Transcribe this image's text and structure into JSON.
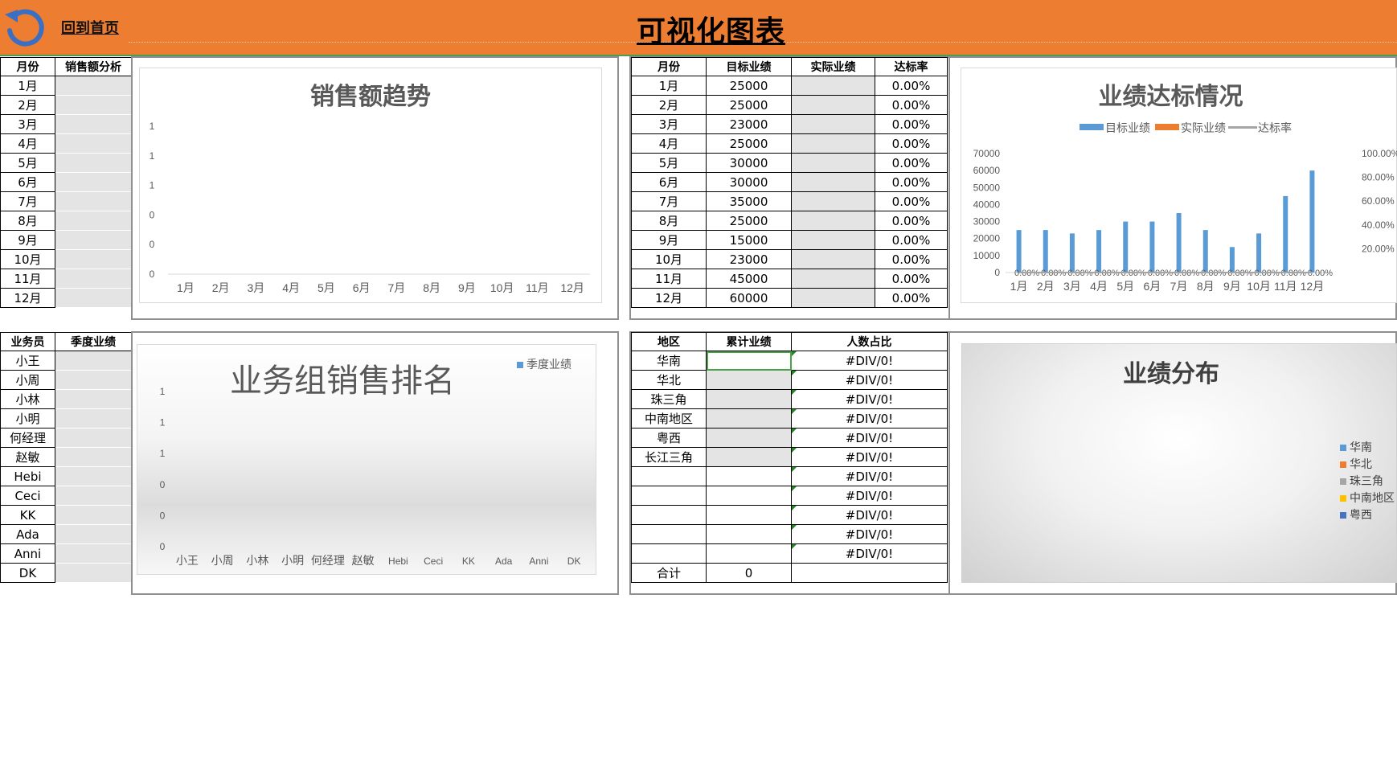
{
  "header": {
    "home_label": "回到首页",
    "title": "可视化图表",
    "bg_color": "#ED7D31"
  },
  "sales_table": {
    "headers": [
      "月份",
      "销售额分析"
    ],
    "rows": [
      "1月",
      "2月",
      "3月",
      "4月",
      "5月",
      "6月",
      "7月",
      "8月",
      "9月",
      "10月",
      "11月",
      "12月"
    ]
  },
  "sales_trend_chart": {
    "title": "销售额趋势",
    "y_ticks": [
      "0",
      "0",
      "0",
      "1",
      "1",
      "1"
    ],
    "x_labels": [
      "1月",
      "2月",
      "3月",
      "4月",
      "5月",
      "6月",
      "7月",
      "8月",
      "9月",
      "10月",
      "11月",
      "12月"
    ]
  },
  "target_table": {
    "headers": [
      "月份",
      "目标业绩",
      "实际业绩",
      "达标率"
    ],
    "rows": [
      {
        "month": "1月",
        "target": "25000",
        "actual": "",
        "rate": "0.00%"
      },
      {
        "month": "2月",
        "target": "25000",
        "actual": "",
        "rate": "0.00%"
      },
      {
        "month": "3月",
        "target": "23000",
        "actual": "",
        "rate": "0.00%"
      },
      {
        "month": "4月",
        "target": "25000",
        "actual": "",
        "rate": "0.00%"
      },
      {
        "month": "5月",
        "target": "30000",
        "actual": "",
        "rate": "0.00%"
      },
      {
        "month": "6月",
        "target": "30000",
        "actual": "",
        "rate": "0.00%"
      },
      {
        "month": "7月",
        "target": "35000",
        "actual": "",
        "rate": "0.00%"
      },
      {
        "month": "8月",
        "target": "25000",
        "actual": "",
        "rate": "0.00%"
      },
      {
        "month": "9月",
        "target": "15000",
        "actual": "",
        "rate": "0.00%"
      },
      {
        "month": "10月",
        "target": "23000",
        "actual": "",
        "rate": "0.00%"
      },
      {
        "month": "11月",
        "target": "45000",
        "actual": "",
        "rate": "0.00%"
      },
      {
        "month": "12月",
        "target": "60000",
        "actual": "",
        "rate": "0.00%"
      }
    ]
  },
  "salesman_table": {
    "headers": [
      "业务员",
      "季度业绩"
    ],
    "rows": [
      "小王",
      "小周",
      "小林",
      "小明",
      "何经理",
      "赵敏",
      "Hebi",
      "Ceci",
      "KK",
      "Ada",
      "Anni",
      "DK"
    ]
  },
  "ranking_chart": {
    "title": "业务组销售排名",
    "legend": "季度业绩",
    "y_ticks": [
      "0",
      "0",
      "0",
      "1",
      "1",
      "1"
    ],
    "x_labels": [
      "小王",
      "小周",
      "小林",
      "小明",
      "何经理",
      "赵敏",
      "Hebi",
      "Ceci",
      "KK",
      "Ada",
      "Anni",
      "DK"
    ]
  },
  "region_table": {
    "headers": [
      "地区",
      "累计业绩",
      "人数占比"
    ],
    "rows": [
      {
        "region": "华南",
        "total": "",
        "ratio": "#DIV/0!"
      },
      {
        "region": "华北",
        "total": "",
        "ratio": "#DIV/0!"
      },
      {
        "region": "珠三角",
        "total": "",
        "ratio": "#DIV/0!"
      },
      {
        "region": "中南地区",
        "total": "",
        "ratio": "#DIV/0!"
      },
      {
        "region": "粤西",
        "total": "",
        "ratio": "#DIV/0!"
      },
      {
        "region": "长江三角",
        "total": "",
        "ratio": "#DIV/0!"
      },
      {
        "region": "",
        "total": "",
        "ratio": "#DIV/0!"
      },
      {
        "region": "",
        "total": "",
        "ratio": "#DIV/0!"
      },
      {
        "region": "",
        "total": "",
        "ratio": "#DIV/0!"
      },
      {
        "region": "",
        "total": "",
        "ratio": "#DIV/0!"
      },
      {
        "region": "",
        "total": "",
        "ratio": "#DIV/0!"
      }
    ],
    "total_label": "合计",
    "total_value": "0"
  },
  "distribution_chart": {
    "title": "业绩分布",
    "legend": [
      {
        "name": "华南",
        "color": "#5B9BD5"
      },
      {
        "name": "华北",
        "color": "#ED7D31"
      },
      {
        "name": "珠三角",
        "color": "#A5A5A5"
      },
      {
        "name": "中南地区",
        "color": "#FFC000"
      },
      {
        "name": "粤西",
        "color": "#4472C4"
      }
    ]
  },
  "chart_data": [
    {
      "type": "line",
      "title": "销售额趋势",
      "categories": [
        "1月",
        "2月",
        "3月",
        "4月",
        "5月",
        "6月",
        "7月",
        "8月",
        "9月",
        "10月",
        "11月",
        "12月"
      ],
      "series": [],
      "y_tick_labels": [
        "0",
        "0",
        "0",
        "1",
        "1",
        "1"
      ]
    },
    {
      "type": "bar",
      "title": "业绩达标情况",
      "categories": [
        "1月",
        "2月",
        "3月",
        "4月",
        "5月",
        "6月",
        "7月",
        "8月",
        "9月",
        "10月",
        "11月",
        "12月"
      ],
      "series": [
        {
          "name": "目标业绩",
          "color": "#5B9BD5",
          "axis": "left",
          "values": [
            25000,
            25000,
            23000,
            25000,
            30000,
            30000,
            35000,
            25000,
            15000,
            23000,
            45000,
            60000
          ]
        },
        {
          "name": "实际业绩",
          "color": "#ED7D31",
          "axis": "left",
          "values": [
            0,
            0,
            0,
            0,
            0,
            0,
            0,
            0,
            0,
            0,
            0,
            0
          ]
        },
        {
          "name": "达标率",
          "color": "#A5A5A5",
          "type": "line",
          "axis": "right",
          "values": [
            0,
            0,
            0,
            0,
            0,
            0,
            0,
            0,
            0,
            0,
            0,
            0
          ],
          "data_labels": [
            "0.00%",
            "0.00%",
            "0.00%",
            "0.00%",
            "0.00%",
            "0.00%",
            "0.00%",
            "0.00%",
            "0.00%",
            "0.00%",
            "0.00%",
            "0.00%"
          ]
        }
      ],
      "legend": [
        "目标业绩",
        "实际业绩",
        "达标率"
      ],
      "legend_position": "top",
      "ylim": [
        0,
        70000
      ],
      "y_ticks": [
        "0",
        "10000",
        "20000",
        "30000",
        "40000",
        "50000",
        "60000",
        "70000"
      ],
      "y2_ticks": [
        "20.00%",
        "40.00%",
        "60.00%",
        "80.00%",
        "100.00%"
      ]
    },
    {
      "type": "bar",
      "title": "业务组销售排名",
      "categories": [
        "小王",
        "小周",
        "小林",
        "小明",
        "何经理",
        "赵敏",
        "Hebi",
        "Ceci",
        "KK",
        "Ada",
        "Anni",
        "DK"
      ],
      "series": [
        {
          "name": "季度业绩",
          "values": []
        }
      ],
      "legend_position": "top-right"
    },
    {
      "type": "pie",
      "title": "业绩分布",
      "categories": [
        "华南",
        "华北",
        "珠三角",
        "中南地区",
        "粤西"
      ],
      "values": [],
      "legend_position": "right"
    }
  ]
}
